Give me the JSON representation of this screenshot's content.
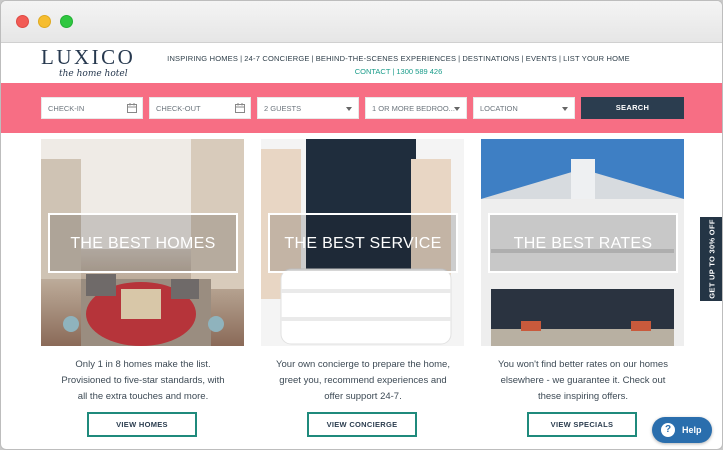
{
  "brand": {
    "name": "LUXICO",
    "tagline": "the home hotel"
  },
  "nav": {
    "items": [
      "INSPIRING HOMES",
      "24-7 CONCIERGE",
      "BEHIND-THE-SCENES EXPERIENCES",
      "DESTINATIONS",
      "EVENTS",
      "LIST YOUR HOME"
    ],
    "contact_label": "CONTACT",
    "phone": "1300 589 426"
  },
  "search": {
    "checkin": "CHECK-IN",
    "checkout": "CHECK-OUT",
    "guests": "2 GUESTS",
    "bedrooms": "1 OR MORE BEDROO...",
    "location": "LOCATION",
    "button": "SEARCH"
  },
  "cards": [
    {
      "overlay": "THE BEST HOMES",
      "text": [
        "Only 1 in 8 homes make the list.",
        "Provisioned to five-star standards, with",
        "all the extra touches and more."
      ],
      "button": "VIEW HOMES"
    },
    {
      "overlay": "THE BEST SERVICE",
      "text": [
        "Your own concierge to prepare the home,",
        "greet you, recommend experiences and",
        "offer support 24-7."
      ],
      "button": "VIEW CONCIERGE"
    },
    {
      "overlay": "THE BEST RATES",
      "text": [
        "You won't find better rates on our homes",
        "elsewhere - we guarantee it. Check out",
        "these inspiring offers."
      ],
      "button": "VIEW SPECIALS"
    }
  ],
  "side_tab": "GET UP TO 30% OFF",
  "help": "Help",
  "colors": {
    "accent_pink": "#f76e84",
    "navy": "#2b3d4f",
    "teal": "#1f8a7c",
    "help_blue": "#2a6ead"
  }
}
